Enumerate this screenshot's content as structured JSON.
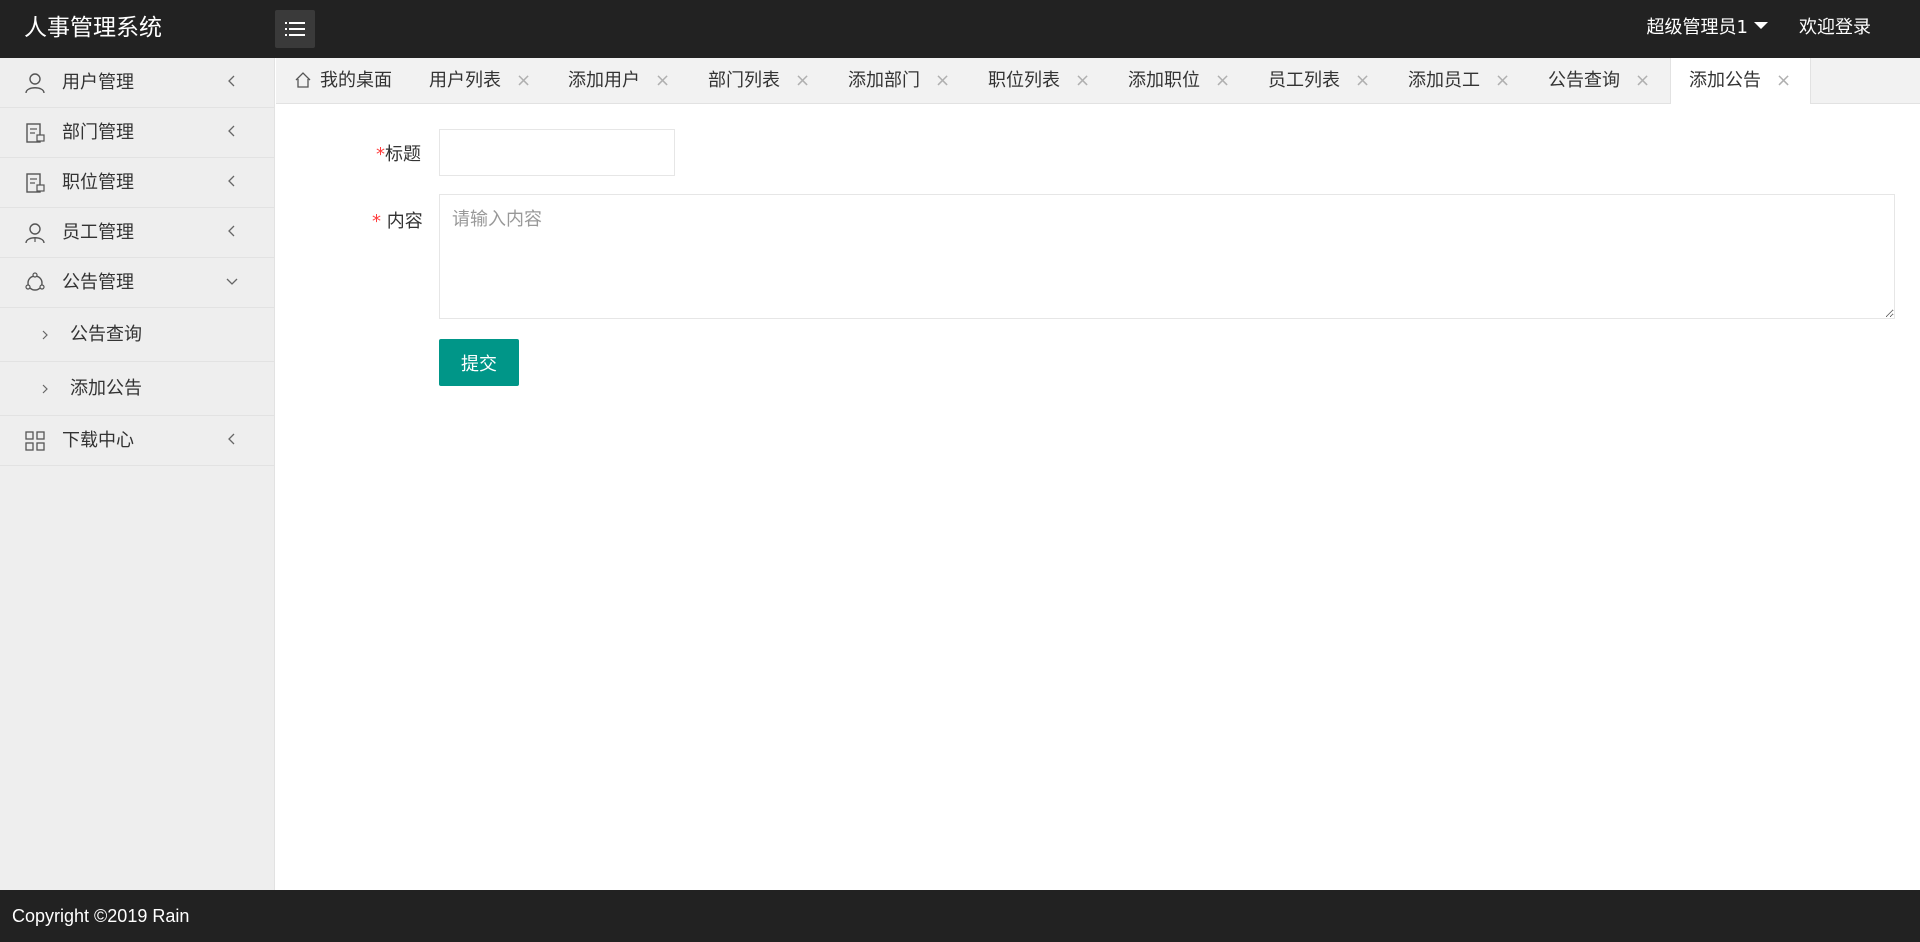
{
  "header": {
    "app_title": "人事管理系统",
    "user_name": "超级管理员1",
    "welcome": "欢迎登录"
  },
  "sidebar": {
    "items": [
      {
        "label": "用户管理",
        "icon": "user-icon"
      },
      {
        "label": "部门管理",
        "icon": "document-lock-icon"
      },
      {
        "label": "职位管理",
        "icon": "document-lock-icon"
      },
      {
        "label": "员工管理",
        "icon": "staff-icon"
      },
      {
        "label": "公告管理",
        "icon": "circle-nodes-icon",
        "expanded": true,
        "children": [
          {
            "label": "公告查询"
          },
          {
            "label": "添加公告"
          }
        ]
      },
      {
        "label": "下载中心",
        "icon": "grid-icon"
      }
    ]
  },
  "tabs": [
    {
      "label": "我的桌面",
      "closable": false,
      "icon": "home-icon"
    },
    {
      "label": "用户列表",
      "closable": true
    },
    {
      "label": "添加用户",
      "closable": true
    },
    {
      "label": "部门列表",
      "closable": true
    },
    {
      "label": "添加部门",
      "closable": true
    },
    {
      "label": "职位列表",
      "closable": true
    },
    {
      "label": "添加职位",
      "closable": true
    },
    {
      "label": "员工列表",
      "closable": true
    },
    {
      "label": "添加员工",
      "closable": true
    },
    {
      "label": "公告查询",
      "closable": true
    },
    {
      "label": "添加公告",
      "closable": true,
      "active": true
    }
  ],
  "tab_close_glyph": "×",
  "form": {
    "required_mark": "*",
    "title_label": "标题",
    "title_value": "",
    "content_label": "内容",
    "content_placeholder": "请输入内容",
    "content_value": "",
    "submit_label": "提交"
  },
  "footer": {
    "copyright": "Copyright ©2019 Rain"
  },
  "colors": {
    "header_bg": "#222222",
    "sidebar_bg": "#eeeeee",
    "primary_button": "#009688",
    "required_mark": "#ff3c3c"
  }
}
